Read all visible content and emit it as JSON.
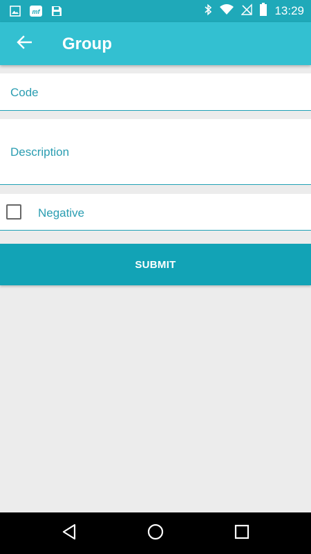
{
  "status_bar": {
    "time": "13:29",
    "icons": [
      "image-icon",
      "app-notification-icon",
      "save-icon",
      "bluetooth-icon",
      "wifi-icon",
      "no-signal-icon",
      "battery-icon"
    ]
  },
  "app_bar": {
    "title": "Group",
    "back_icon": "arrow-left-icon"
  },
  "form": {
    "code_placeholder": "Code",
    "description_placeholder": "Description",
    "negative_label": "Negative",
    "negative_checked": false,
    "submit_label": "SUBMIT"
  },
  "nav_bar": {
    "icons": [
      "back-triangle-icon",
      "home-circle-icon",
      "recents-square-icon"
    ]
  },
  "colors": {
    "status_bar": "#1fa9b9",
    "app_bar": "#33c0d1",
    "accent": "#12a3b6",
    "background": "#ececec"
  }
}
